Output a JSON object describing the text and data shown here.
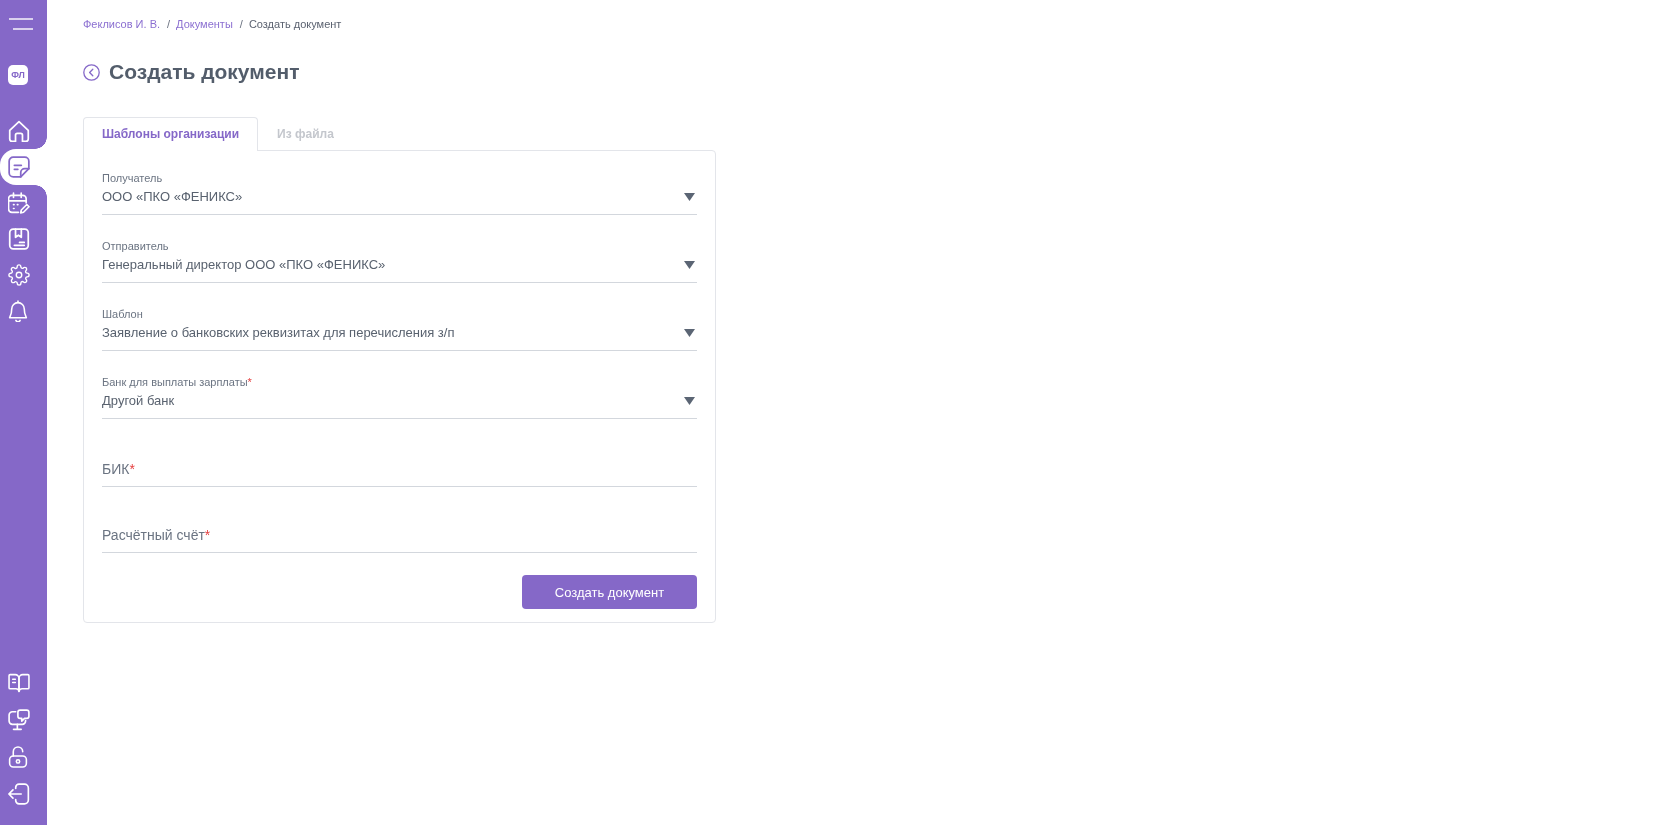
{
  "sidebar": {
    "profile_badge": "ФЛ",
    "nav_items": [
      {
        "selected": false
      },
      {
        "selected": true
      },
      {
        "selected": false
      },
      {
        "selected": false
      },
      {
        "selected": false
      },
      {
        "selected": false
      }
    ]
  },
  "breadcrumb": {
    "items": [
      {
        "label": "Феклисов И. В.",
        "current": false
      },
      {
        "separator": "/",
        "label": "Документы",
        "current": false
      },
      {
        "separator": "/",
        "label": "Создать документ",
        "current": true
      }
    ]
  },
  "page_title": "Создать документ",
  "tabs": [
    {
      "label": "Шаблоны организации",
      "selected": true
    },
    {
      "label": "Из файла",
      "selected": false
    }
  ],
  "form": {
    "fields": [
      {
        "kind": "select",
        "label": "Получатель",
        "value": "ООО «ПКО «ФЕНИКС»"
      },
      {
        "kind": "select",
        "label": "Отправитель",
        "value": "Генеральный директор ООО «ПКО «ФЕНИКС»"
      },
      {
        "kind": "select",
        "label": "Шаблон",
        "value": "Заявление о банковских реквизитах для перечисления з/п"
      },
      {
        "kind": "select",
        "label": "Банк для выплаты зарплаты",
        "required_mark": "*",
        "value": "Другой банк"
      },
      {
        "kind": "text",
        "label": "БИК",
        "required_mark": "*"
      },
      {
        "kind": "text",
        "label": "Расчётный счёт",
        "required_mark": "*"
      }
    ],
    "submit_button": "Создать документ"
  }
}
